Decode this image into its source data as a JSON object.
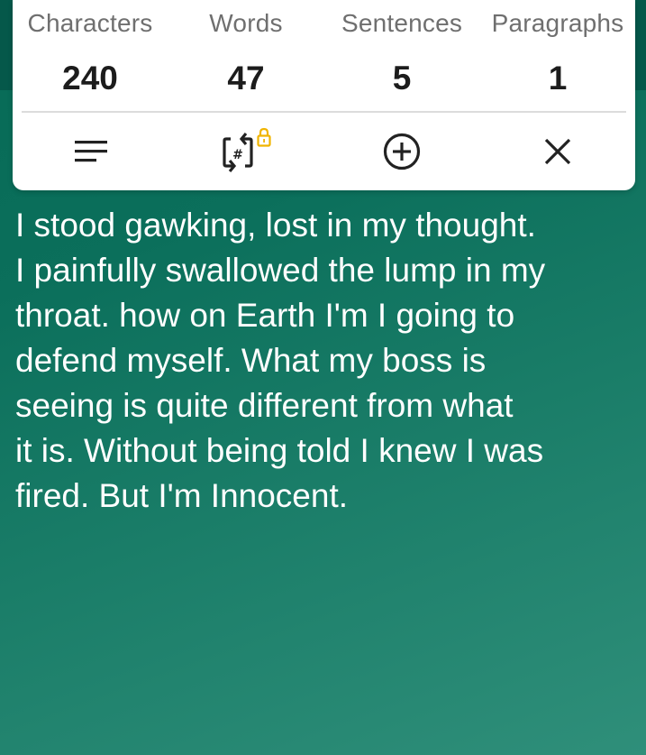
{
  "stats": [
    {
      "label": "Characters",
      "value": "240"
    },
    {
      "label": "Words",
      "value": "47"
    },
    {
      "label": "Sentences",
      "value": "5"
    },
    {
      "label": "Paragraphs",
      "value": "1"
    }
  ],
  "toolbar": {
    "icons": [
      "menu-icon",
      "hash-sync-icon",
      "lock-icon",
      "add-circle-icon",
      "close-icon"
    ],
    "lock_color": "#f0b400"
  },
  "body_text": {
    "lines": [
      "I stood gawking, lost in my thought.",
      "I painfully swallowed the lump in my",
      "throat. how on Earth I'm I going to",
      "defend myself. What my boss is",
      "seeing is quite different from what",
      "it is. Without being told I knew I was",
      "fired. But I'm Innocent."
    ]
  },
  "colors": {
    "background": "#0b6f5b",
    "card": "#ffffff",
    "text": "#ffffff",
    "label": "#6f6f6f",
    "value": "#1c1c1c"
  }
}
